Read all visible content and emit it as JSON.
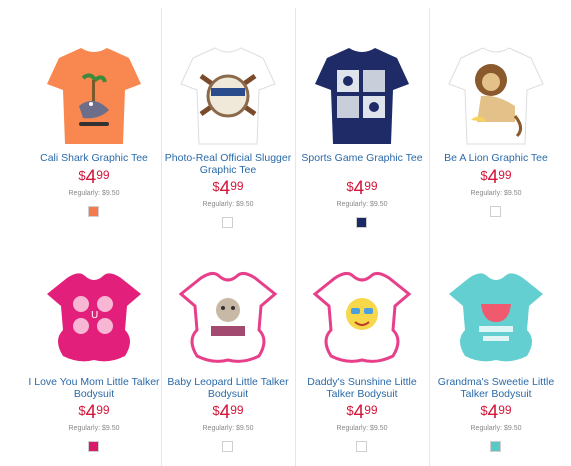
{
  "products": [
    {
      "name": "Cali Shark Graphic Tee",
      "currency": "$",
      "dollars": "4",
      "cents": "99",
      "regular": "Regularly: $9.50",
      "swatch": "#f57b4e"
    },
    {
      "name": "Photo-Real Official Slugger Graphic Tee",
      "currency": "$",
      "dollars": "4",
      "cents": "99",
      "regular": "Regularly: $9.50",
      "swatch": "#ffffff"
    },
    {
      "name": "Sports Game Graphic Tee",
      "currency": "$",
      "dollars": "4",
      "cents": "99",
      "regular": "Regularly: $9.50",
      "swatch": "#1c2a63"
    },
    {
      "name": "Be A Lion Graphic Tee",
      "currency": "$",
      "dollars": "4",
      "cents": "99",
      "regular": "Regularly: $9.50",
      "swatch": "#ffffff"
    },
    {
      "name": "I Love You Mom Little Talker Bodysuit",
      "currency": "$",
      "dollars": "4",
      "cents": "99",
      "regular": "Regularly: $9.50",
      "swatch": "#d81a6a"
    },
    {
      "name": "Baby Leopard Little Talker Bodysuit",
      "currency": "$",
      "dollars": "4",
      "cents": "99",
      "regular": "Regularly: $9.50",
      "swatch": "#ffffff"
    },
    {
      "name": "Daddy's Sunshine Little Talker Bodysuit",
      "currency": "$",
      "dollars": "4",
      "cents": "99",
      "regular": "Regularly: $9.50",
      "swatch": "#ffffff"
    },
    {
      "name": "Grandma's Sweetie Little Talker Bodysuit",
      "currency": "$",
      "dollars": "4",
      "cents": "99",
      "regular": "Regularly: $9.50",
      "swatch": "#5bc8c8"
    }
  ],
  "shirt_colors": [
    "#f8884f",
    "#ffffff",
    "#1e2b66",
    "#ffffff",
    "#e21f7a",
    "#ffffff",
    "#ffffff",
    "#63cfd0"
  ],
  "trim_colors": [
    "#f8884f",
    "#ffffff",
    "#1e2b66",
    "#ffffff",
    "#e21f7a",
    "#e83f8a",
    "#e83f8a",
    "#63cfd0"
  ]
}
